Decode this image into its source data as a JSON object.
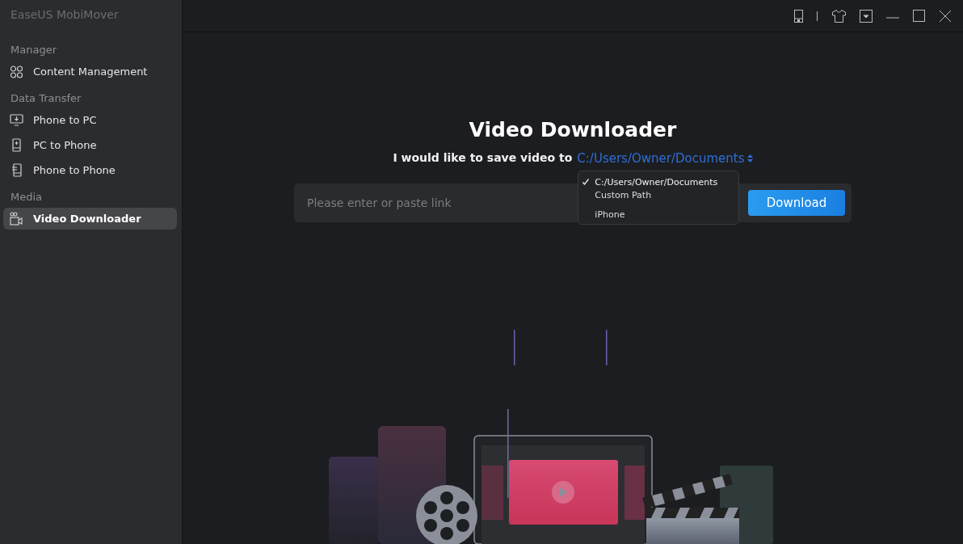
{
  "app_title": "EaseUS MobiMover",
  "sidebar": {
    "sections": [
      {
        "heading": "Manager",
        "items": [
          {
            "label": "Content Management",
            "selected": false
          }
        ]
      },
      {
        "heading": "Data Transfer",
        "items": [
          {
            "label": "Phone to PC",
            "selected": false
          },
          {
            "label": "PC to Phone",
            "selected": false
          },
          {
            "label": "Phone to Phone",
            "selected": false
          }
        ]
      },
      {
        "heading": "Media",
        "items": [
          {
            "label": "Video Downloader",
            "selected": true
          }
        ]
      }
    ]
  },
  "page": {
    "title": "Video Downloader",
    "save_prompt": "I would like to save video to",
    "save_path": "C:/Users/Owner/Documents",
    "path_menu": {
      "groups": [
        {
          "options": [
            {
              "label": "C:/Users/Owner/Documents",
              "selected": true
            },
            {
              "label": "Custom Path",
              "selected": false
            }
          ]
        },
        {
          "options": [
            {
              "label": "iPhone",
              "selected": false
            }
          ]
        }
      ]
    },
    "link_field": {
      "placeholder": "Please enter or paste link"
    },
    "download_button": "Download"
  }
}
